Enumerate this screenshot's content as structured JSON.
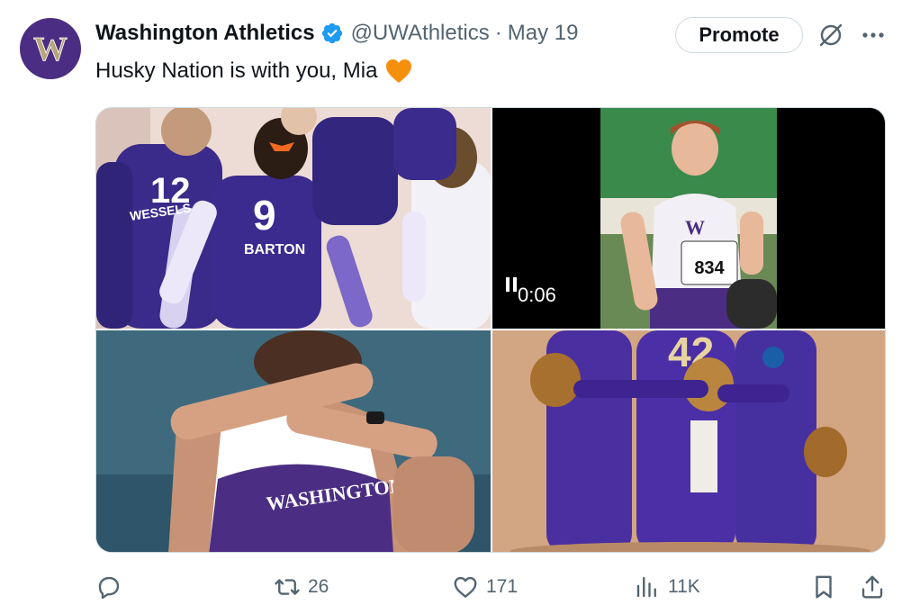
{
  "tweet": {
    "author_name": "Washington Athletics",
    "handle": "@UWAthletics",
    "separator": "·",
    "date": "May 19",
    "text": "Husky Nation is with you, Mia",
    "avatar_letter": "W",
    "brand_color": "#4b2e83",
    "verified_color": "#1d9bf0",
    "emoji_color": "#f4900c"
  },
  "header": {
    "promote_label": "Promote"
  },
  "media": {
    "video_time": "0:06",
    "photo1_numbers": [
      "12",
      "9"
    ],
    "photo1_names": [
      "WESSELS",
      "BARTON"
    ],
    "photo2_bib": "834",
    "photo3_text": "WASHINGTON",
    "photo4_number": "42"
  },
  "actions": {
    "retweets": "26",
    "likes": "171",
    "views": "11K"
  }
}
